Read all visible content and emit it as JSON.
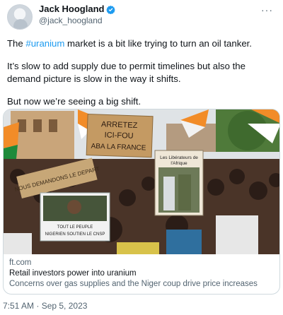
{
  "author": {
    "name": "Jack Hoogland",
    "handle": "@jack_hoogland"
  },
  "icons": {
    "verified": "verified-badge-icon",
    "more": "more-options-icon"
  },
  "tweet": {
    "p1_prefix": "The ",
    "p1_hashtag": "#uranium",
    "p1_suffix": " market is a bit like trying to turn an oil tanker.",
    "p2": "It’s slow to add supply due to permit timelines but also the demand picture is slow in the way it shifts.",
    "p3": "But now we’re seeing a big shift."
  },
  "photo": {
    "sign_left": "ARRETEZ ICI-FOU ABA LA FRANCE",
    "sign_poster_title": "Les Libérateurs de l'Afrique",
    "sign_bottom": "TOUT LE PEUPLE NIGERIEN SOUTIEN LE CNSP",
    "sign_back": "NOUS DEMANDONS LE DEPART"
  },
  "card": {
    "domain": "ft.com",
    "title": "Retail investors power into uranium",
    "description": "Concerns over gas supplies and the Niger coup drive price increases"
  },
  "timestamp": "7:51 AM · Sep 5, 2023",
  "colors": {
    "accent": "#1d9bf0",
    "secondary_text": "#536471",
    "border": "#cfd9de"
  }
}
